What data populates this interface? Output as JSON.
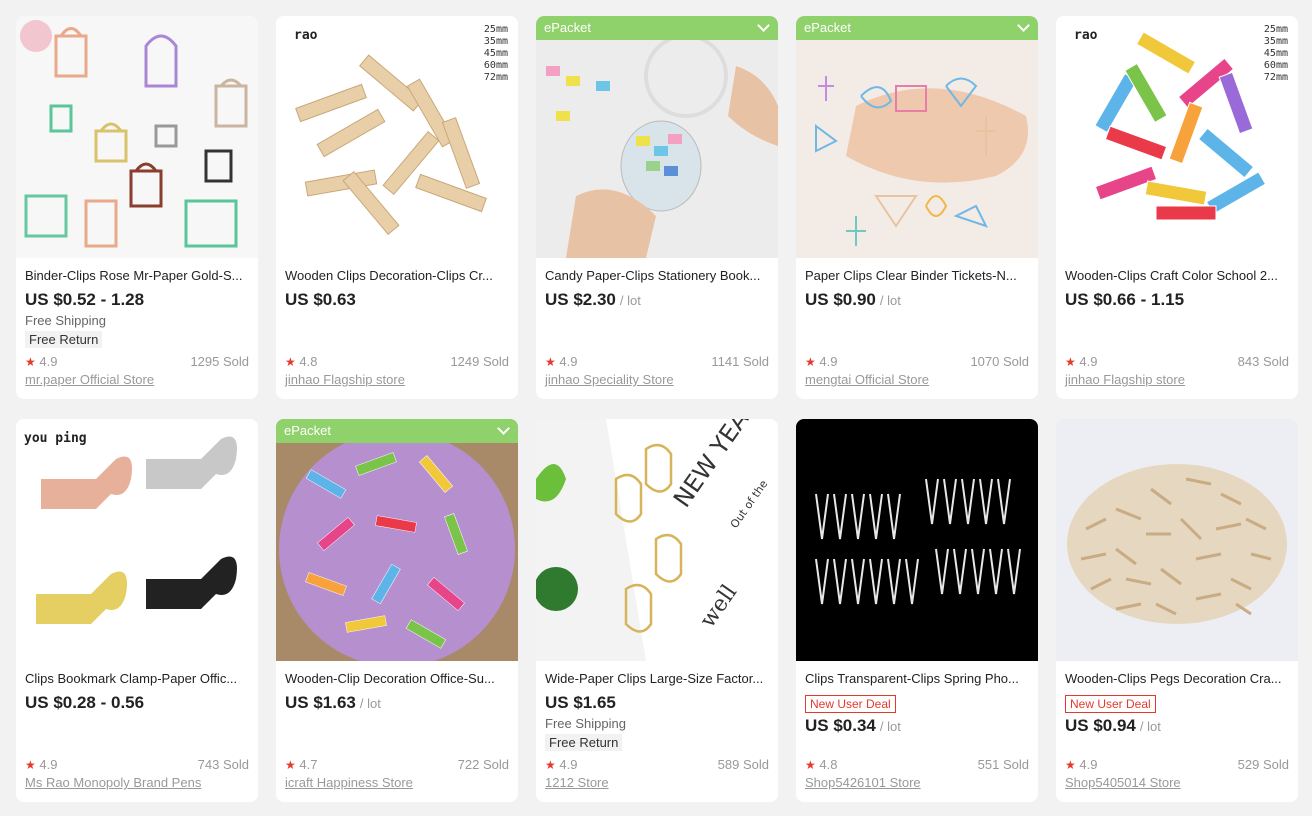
{
  "products": [
    {
      "title": "Binder-Clips Rose Mr-Paper Gold-S...",
      "price": "US $0.52 - 1.28",
      "unit": "",
      "shipping": "Free Shipping",
      "free_return": "Free Return",
      "rating": "4.9",
      "sold": "1295 Sold",
      "store": "mr.paper Official Store",
      "epacket": "",
      "deal": ""
    },
    {
      "title": "Wooden Clips Decoration-Clips Cr...",
      "price": "US $0.63",
      "unit": "",
      "shipping": "",
      "free_return": "",
      "rating": "4.8",
      "sold": "1249 Sold",
      "store": "jinhao Flagship store",
      "epacket": "",
      "deal": "",
      "brand": "rao",
      "sizes": [
        "25mm",
        "35mm",
        "45mm",
        "60mm",
        "72mm"
      ]
    },
    {
      "title": "Candy Paper-Clips Stationery Book...",
      "price": "US $2.30",
      "unit": "/ lot",
      "shipping": "",
      "free_return": "",
      "rating": "4.9",
      "sold": "1141 Sold",
      "store": "jinhao Speciality Store",
      "epacket": "ePacket",
      "deal": ""
    },
    {
      "title": "Paper Clips Clear Binder Tickets-N...",
      "price": "US $0.90",
      "unit": "/ lot",
      "shipping": "",
      "free_return": "",
      "rating": "4.9",
      "sold": "1070 Sold",
      "store": "mengtai Official Store",
      "epacket": "ePacket",
      "deal": ""
    },
    {
      "title": "Wooden-Clips Craft Color School 2...",
      "price": "US $0.66 - 1.15",
      "unit": "",
      "shipping": "",
      "free_return": "",
      "rating": "4.9",
      "sold": "843 Sold",
      "store": "jinhao Flagship store",
      "epacket": "",
      "deal": "",
      "brand": "rao",
      "sizes": [
        "25mm",
        "35mm",
        "45mm",
        "60mm",
        "72mm"
      ]
    },
    {
      "title": "Clips Bookmark Clamp-Paper Offic...",
      "price": "US $0.28 - 0.56",
      "unit": "",
      "shipping": "",
      "free_return": "",
      "rating": "4.9",
      "sold": "743 Sold",
      "store": "Ms Rao Monopoly Brand Pens",
      "epacket": "",
      "deal": "",
      "brand": "you ping"
    },
    {
      "title": "Wooden-Clip Decoration Office-Su...",
      "price": "US $1.63",
      "unit": "/ lot",
      "shipping": "",
      "free_return": "",
      "rating": "4.7",
      "sold": "722 Sold",
      "store": "icraft Happiness Store",
      "epacket": "ePacket",
      "deal": ""
    },
    {
      "title": "Wide-Paper Clips Large-Size Factor...",
      "price": "US $1.65",
      "unit": "",
      "shipping": "Free Shipping",
      "free_return": "Free Return",
      "rating": "4.9",
      "sold": "589 Sold",
      "store": "1212 Store",
      "epacket": "",
      "deal": "",
      "img_text": [
        "NEW YEA",
        "Out of the",
        "well"
      ]
    },
    {
      "title": "Clips Transparent-Clips Spring Pho...",
      "price": "US $0.34",
      "unit": "/ lot",
      "shipping": "",
      "free_return": "",
      "rating": "4.8",
      "sold": "551 Sold",
      "store": "Shop5426101 Store",
      "epacket": "",
      "deal": "New User Deal"
    },
    {
      "title": "Wooden-Clips Pegs Decoration Cra...",
      "price": "US $0.94",
      "unit": "/ lot",
      "shipping": "",
      "free_return": "",
      "rating": "4.9",
      "sold": "529 Sold",
      "store": "Shop5405014 Store",
      "epacket": "",
      "deal": "New User Deal"
    }
  ],
  "icons": {
    "star": "star-icon",
    "chevron": "chevron-down-icon"
  },
  "colors": {
    "epacket": "#8fd16a",
    "deal": "#e5392c",
    "star": "#e5392c"
  }
}
